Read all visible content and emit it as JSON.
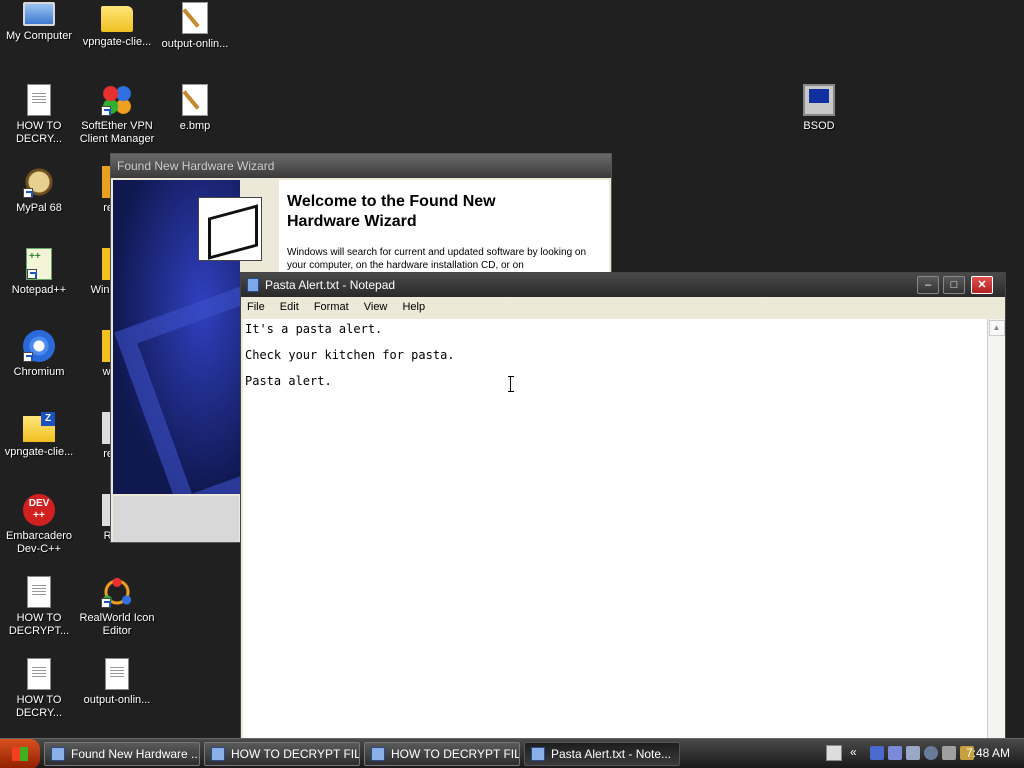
{
  "desktop_icons": [
    {
      "label": "My Computer"
    },
    {
      "label": "vpngate-clie..."
    },
    {
      "label": "output-onlin..."
    },
    {
      "label": "HOW TO DECRY..."
    },
    {
      "label": "SoftEther VPN Client Manager"
    },
    {
      "label": "e.bmp"
    },
    {
      "label": "MyPal 68"
    },
    {
      "label": "resha"
    },
    {
      "label": "Notepad++"
    },
    {
      "label": "Wind ALL I"
    },
    {
      "label": "Chromium"
    },
    {
      "label": "windo"
    },
    {
      "label": "vpngate-clie..."
    },
    {
      "label": "resha"
    },
    {
      "label": "Embarcadero Dev-C++"
    },
    {
      "label": "RWIc"
    },
    {
      "label": "HOW TO DECRYPT..."
    },
    {
      "label": "RealWorld Icon Editor"
    },
    {
      "label": "HOW TO DECRY..."
    },
    {
      "label": "output-onlin..."
    },
    {
      "label": "BSOD"
    }
  ],
  "wizard": {
    "title": "Found New Hardware Wizard",
    "heading": "Welcome to the Found New Hardware Wizard",
    "body": "Windows will search for current and updated software by looking on your computer, on the hardware installation CD, or on"
  },
  "notepad": {
    "title": "Pasta Alert.txt - Notepad",
    "menu": [
      "File",
      "Edit",
      "Format",
      "View",
      "Help"
    ],
    "lines": [
      "It's a pasta alert.",
      "Check your kitchen for pasta.",
      "Pasta alert."
    ],
    "min_label": "–",
    "max_label": "□",
    "close_label": "✕"
  },
  "taskbar": {
    "tasks": [
      {
        "label": "Found New Hardware ..."
      },
      {
        "label": "HOW TO DECRYPT FIL..."
      },
      {
        "label": "HOW TO DECRYPT FIL..."
      },
      {
        "label": "Pasta Alert.txt - Note..."
      }
    ],
    "clock": "7:48 AM",
    "chevron": "«"
  },
  "dev_icon_text": "DEV ++"
}
